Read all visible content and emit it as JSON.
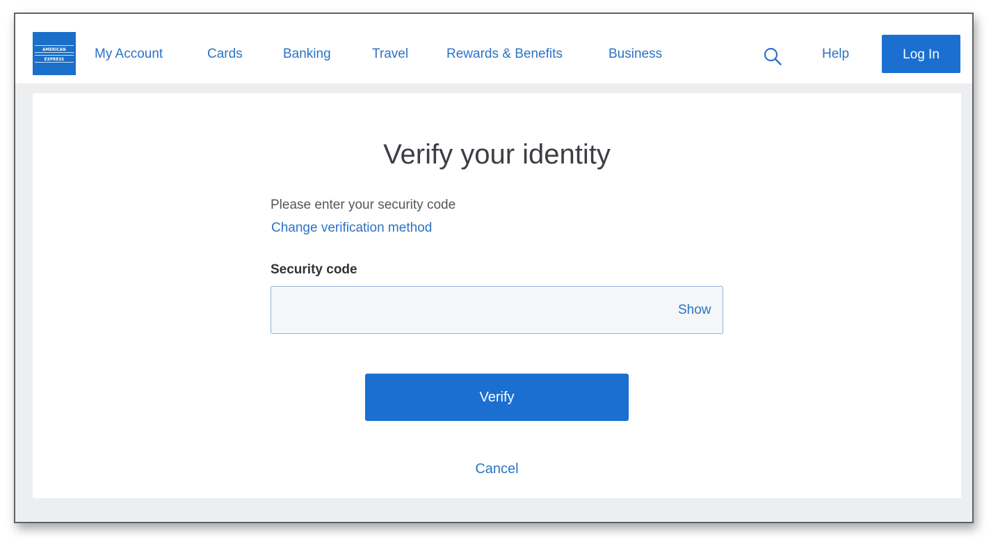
{
  "brand": {
    "logo_line1": "AMERICAN",
    "logo_line2": "EXPRESS",
    "color": "#1a6fc8"
  },
  "nav": {
    "items": [
      {
        "label": "My Account"
      },
      {
        "label": "Cards"
      },
      {
        "label": "Banking"
      },
      {
        "label": "Travel"
      },
      {
        "label": "Rewards & Benefits"
      },
      {
        "label": "Business"
      }
    ],
    "search_icon": "search-icon",
    "help_label": "Help",
    "login_label": "Log In"
  },
  "form": {
    "title": "Verify your identity",
    "instruction": "Please enter your security code",
    "change_method_label": "Change verification method",
    "field_label": "Security code",
    "field_value": "",
    "field_placeholder": "",
    "show_label": "Show",
    "verify_label": "Verify",
    "cancel_label": "Cancel"
  },
  "colors": {
    "accent": "#1a6fd0",
    "link": "#2b73c4",
    "page_background": "#eceef0"
  }
}
